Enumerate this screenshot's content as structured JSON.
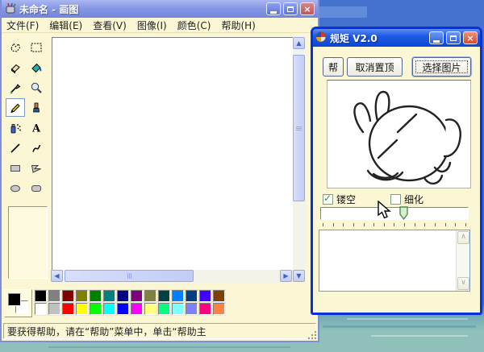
{
  "desktop": {
    "wallpaper_top_color": "#3A68C4",
    "wallpaper_bottom_color": "#8FC0BA"
  },
  "paint_window": {
    "title": "未命名 - 画图",
    "menu": {
      "items": [
        {
          "label": "文件(F)"
        },
        {
          "label": "编辑(E)"
        },
        {
          "label": "查看(V)"
        },
        {
          "label": "图像(I)"
        },
        {
          "label": "颜色(C)"
        },
        {
          "label": "帮助(H)"
        }
      ]
    },
    "tools": [
      "freeform-select",
      "select",
      "eraser",
      "fill",
      "color-picker",
      "magnifier",
      "pencil",
      "brush",
      "airbrush",
      "text",
      "line",
      "curve",
      "rectangle",
      "polygon",
      "ellipse",
      "rounded-rectangle"
    ],
    "selected_tool": "pencil",
    "palette": {
      "foreground": "#000000",
      "background": "#FFFFFF",
      "row1": [
        "#000000",
        "#808080",
        "#800000",
        "#808000",
        "#008000",
        "#008080",
        "#000080",
        "#800080",
        "#808040",
        "#004040",
        "#0080FF",
        "#004080",
        "#4000FF",
        "#804000"
      ],
      "row2": [
        "#FFFFFF",
        "#C0C0C0",
        "#FF0000",
        "#FFFF00",
        "#00FF00",
        "#00FFFF",
        "#0000FF",
        "#FF00FF",
        "#FFFF80",
        "#00FF80",
        "#80FFFF",
        "#8080FF",
        "#FF0080",
        "#FF8040"
      ]
    },
    "status_bar": {
      "text": "要获得帮助，请在“帮助”菜单中，单击“帮助主"
    }
  },
  "tool_window": {
    "title": "规矩  V2.0",
    "accent_border_color": "#0831D9",
    "buttons": [
      {
        "label": "帮"
      },
      {
        "label": "取消置顶"
      },
      {
        "label": "选择图片",
        "focused": true
      }
    ],
    "checkboxes": [
      {
        "label": "镂空",
        "checked": true
      },
      {
        "label": "细化",
        "checked": false
      }
    ],
    "slider": {
      "value_percent": 56,
      "ticks": 15
    }
  }
}
